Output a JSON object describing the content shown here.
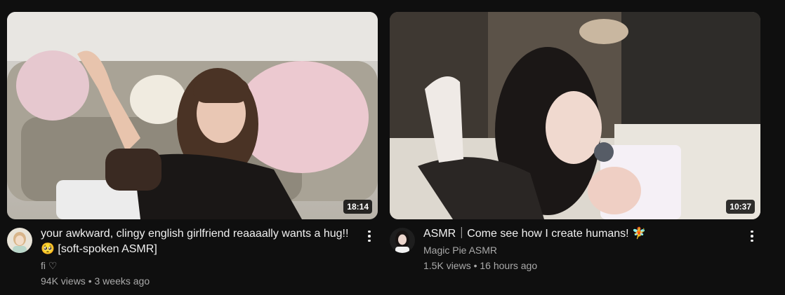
{
  "videos": [
    {
      "title": "your awkward, clingy english girlfriend reaaaally wants a hug!! 🥺 [soft-spoken ASMR]",
      "duration": "18:14",
      "channel": "fi ♡",
      "views": "94K views",
      "age": "3 weeks ago",
      "thumbnail_icon": "video-thumbnail-image",
      "avatar_icon": "channel-avatar-image"
    },
    {
      "title": "ASMR｜Come see how I create humans! 🧚",
      "duration": "10:37",
      "channel": "Magic Pie ASMR",
      "views": "1.5K views",
      "age": "16 hours ago",
      "thumbnail_icon": "video-thumbnail-image",
      "avatar_icon": "channel-avatar-image"
    }
  ],
  "separator": "•",
  "more_icon": "more-vert-icon"
}
